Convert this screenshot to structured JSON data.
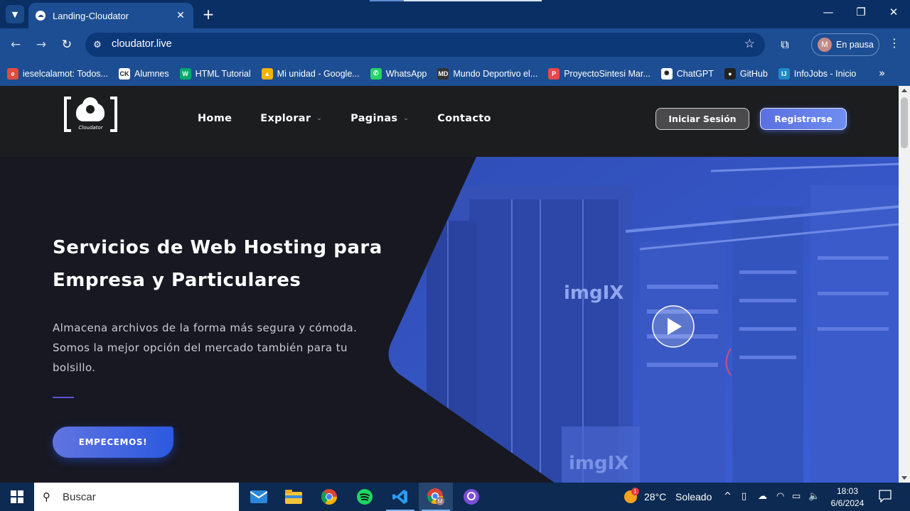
{
  "browser": {
    "tab": {
      "title": "Landing-Cloudator"
    },
    "url": "cloudator.live",
    "profile": {
      "initial": "M",
      "label": "En pausa"
    },
    "bookmarks": [
      {
        "label": "ieselcalamot: Todos...",
        "color": "#e34a3b",
        "glyph": "e"
      },
      {
        "label": "Alumnes",
        "color": "#ffffff",
        "glyph": "CK"
      },
      {
        "label": "HTML Tutorial",
        "color": "#04aa6d",
        "glyph": "W"
      },
      {
        "label": "Mi unidad - Google...",
        "color": "#f4b400",
        "glyph": "▲"
      },
      {
        "label": "WhatsApp",
        "color": "#25d366",
        "glyph": "✆"
      },
      {
        "label": "Mundo Deportivo el...",
        "color": "#333333",
        "glyph": "MD"
      },
      {
        "label": "ProyectoSintesi Mar...",
        "color": "#e8484a",
        "glyph": "P"
      },
      {
        "label": "ChatGPT",
        "color": "#ffffff",
        "glyph": "✺"
      },
      {
        "label": "GitHub",
        "color": "#222222",
        "glyph": "●"
      },
      {
        "label": "InfoJobs - Inicio",
        "color": "#2088c8",
        "glyph": "IJ"
      }
    ]
  },
  "site": {
    "logo_text": "Cloudator",
    "nav": [
      {
        "label": "Home",
        "dropdown": false
      },
      {
        "label": "Explorar",
        "dropdown": true
      },
      {
        "label": "Paginas",
        "dropdown": true
      },
      {
        "label": "Contacto",
        "dropdown": false
      }
    ],
    "login_label": "Iniciar Sesión",
    "register_label": "Registrarse",
    "hero": {
      "title": "Servicios de Web Hosting para Empresa y Particulares",
      "text": "Almacena archivos de la forma más segura y cómoda. Somos la mejor opción del mercado también para tu bolsillo.",
      "cta_label": "EMPECEMOS!",
      "image_label": "imgIX"
    }
  },
  "taskbar": {
    "search_label": "Buscar",
    "weather": {
      "temp": "28°C",
      "condition": "Soleado",
      "badge": "1"
    },
    "time": "18:03",
    "date": "6/6/2024"
  },
  "colors": {
    "accent": "#5b6fe0",
    "hero_overlay": "#3a55cf",
    "chrome": "#1d4e93"
  }
}
